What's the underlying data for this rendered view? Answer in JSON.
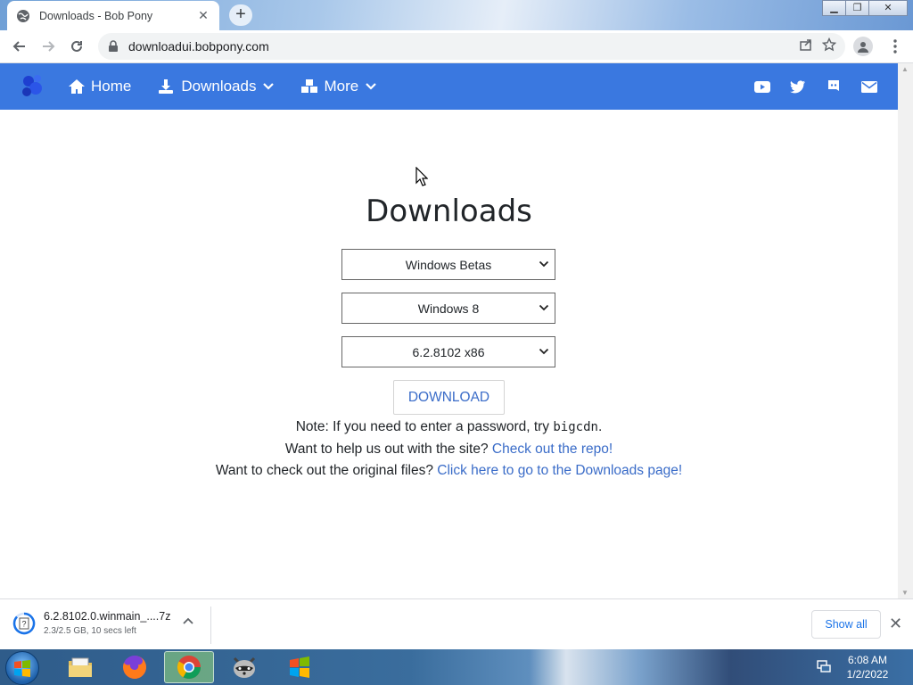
{
  "browser": {
    "tab_title": "Downloads - Bob Pony",
    "new_tab_symbol": "+",
    "url": "downloadui.bobpony.com"
  },
  "navbar": {
    "items": [
      {
        "label": "Home",
        "icon": "home-icon"
      },
      {
        "label": "Downloads",
        "icon": "download-icon",
        "dropdown": true
      },
      {
        "label": "More",
        "icon": "cubes-icon",
        "dropdown": true
      }
    ],
    "social_icons": [
      "youtube-icon",
      "twitter-icon",
      "discord-icon",
      "envelope-icon"
    ],
    "color": "#3a78e0"
  },
  "main": {
    "title": "Downloads",
    "selects": [
      {
        "value": "Windows Betas"
      },
      {
        "value": "Windows 8"
      },
      {
        "value": "6.2.8102 x86"
      }
    ],
    "download_button": "DOWNLOAD",
    "note_prefix": "Note: If you need to enter a password, try ",
    "note_code": "bigcdn",
    "note_suffix": ".",
    "help_text": "Want to help us out with the site? ",
    "help_link": "Check out the repo!",
    "files_text": "Want to check out the original files? ",
    "files_link": "Click here to go to the Downloads page!",
    "link_color": "#3a6cc8"
  },
  "download_shelf": {
    "file_name": "6.2.8102.0.winmain_....7z",
    "status": "2.3/2.5 GB, 10 secs left",
    "show_all": "Show all"
  },
  "taskbar": {
    "time": "6:08 AM",
    "date": "1/2/2022",
    "apps": [
      "explorer-icon",
      "firefox-icon",
      "chrome-icon",
      "raccoon-icon",
      "windows-logo-icon"
    ]
  }
}
